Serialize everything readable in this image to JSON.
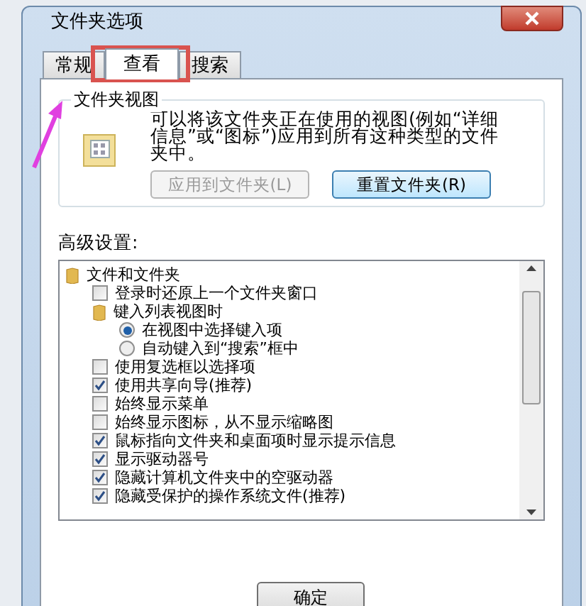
{
  "window": {
    "title": "文件夹选项"
  },
  "tabs": [
    {
      "label": "常规",
      "selected": false
    },
    {
      "label": "查看",
      "selected": true
    },
    {
      "label": "搜索",
      "selected": false
    }
  ],
  "folder_views": {
    "title": "文件夹视图",
    "description": "可以将该文件夹正在使用的视图(例如“详细信息”或“图标”)应用到所有这种类型的文件夹中。",
    "buttons": [
      {
        "label": "应用到文件夹(L)",
        "disabled": true
      },
      {
        "label": "重置文件夹(R)",
        "disabled": false
      }
    ]
  },
  "advanced_settings": {
    "label": "高级设置:",
    "items": [
      {
        "kind": "folder",
        "label": "文件和文件夹",
        "children": [
          {
            "kind": "checkbox",
            "label": "登录时还原上一个文件夹窗口",
            "checked": false
          },
          {
            "kind": "folder",
            "label": "键入列表视图时",
            "children": [
              {
                "kind": "radio",
                "label": "在视图中选择键入项",
                "selected": true
              },
              {
                "kind": "radio",
                "label": "自动键入到“搜索”框中",
                "selected": false
              }
            ]
          },
          {
            "kind": "checkbox",
            "label": "使用复选框以选择项",
            "checked": false
          },
          {
            "kind": "checkbox",
            "label": "使用共享向导(推荐)",
            "checked": true
          },
          {
            "kind": "checkbox",
            "label": "始终显示菜单",
            "checked": false
          },
          {
            "kind": "checkbox",
            "label": "始终显示图标，从不显示缩略图",
            "checked": false
          },
          {
            "kind": "checkbox",
            "label": "鼠标指向文件夹和桌面项时显示提示信息",
            "checked": true
          },
          {
            "kind": "checkbox",
            "label": "显示驱动器号",
            "checked": true
          },
          {
            "kind": "checkbox",
            "label": "隐藏计算机文件夹中的空驱动器",
            "checked": true
          },
          {
            "kind": "checkbox",
            "label": "隐藏受保护的操作系统文件(推荐)",
            "checked": true
          }
        ]
      }
    ]
  },
  "footer_buttons": [
    "确定"
  ],
  "annotations": {
    "highlight_box": true,
    "arrow": true
  }
}
